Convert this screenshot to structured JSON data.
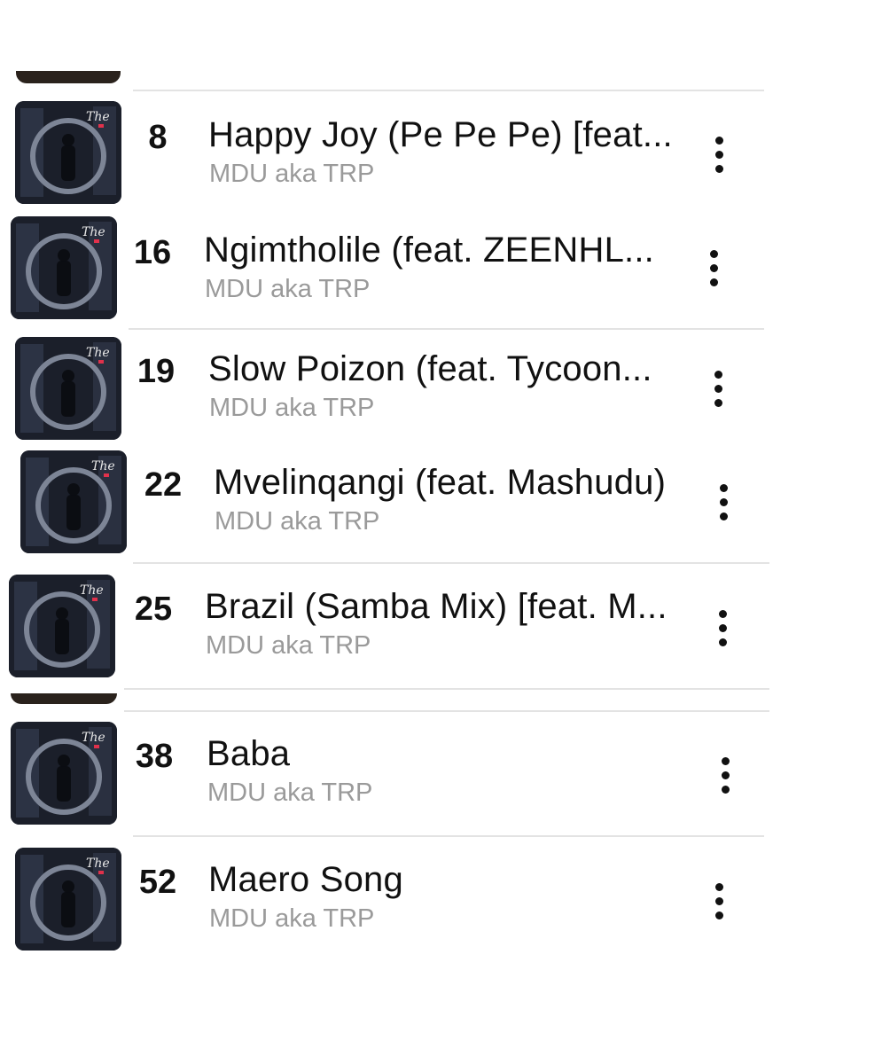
{
  "tracks": [
    {
      "rank": "8",
      "title": "Happy Joy (Pe Pe Pe) [feat...",
      "artist": "MDU aka TRP"
    },
    {
      "rank": "16",
      "title": "Ngimtholile (feat. ZEENHL...",
      "artist": "MDU aka TRP"
    },
    {
      "rank": "19",
      "title": "Slow Poizon (feat. Tycoon...",
      "artist": "MDU aka TRP"
    },
    {
      "rank": "22",
      "title": "Mvelinqangi (feat. Mashudu)",
      "artist": "MDU aka TRP"
    },
    {
      "rank": "25",
      "title": "Brazil (Samba Mix) [feat. M...",
      "artist": "MDU aka TRP"
    },
    {
      "rank": "38",
      "title": "Baba",
      "artist": "MDU aka TRP"
    },
    {
      "rank": "52",
      "title": "Maero Song",
      "artist": "MDU aka TRP"
    }
  ],
  "icons": {
    "artwork": "album-artwork-icon",
    "more": "more-options-icon"
  },
  "colors": {
    "title": "#111111",
    "artist": "#9a9a9a",
    "divider": "#e3e3e3",
    "artwork_bg": "#1b1f2a",
    "artwork_accent": "#e0314b"
  }
}
